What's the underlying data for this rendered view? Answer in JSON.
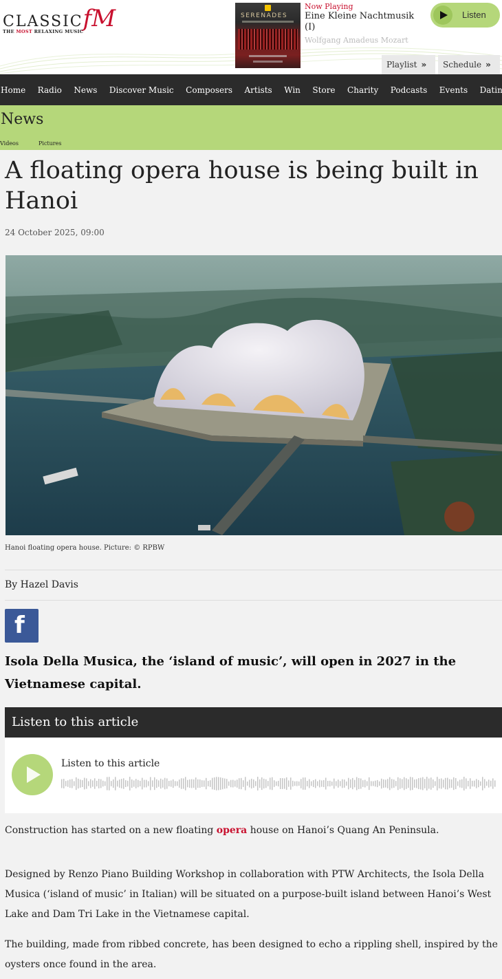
{
  "header": {
    "logo": {
      "main_classic": "CLASSIC",
      "main_fm": "fM",
      "tagline_pre": "THE ",
      "tagline_red": "MOST",
      "tagline_post": " RELAXING MUSIC"
    },
    "album_art": {
      "title": "SERENADES"
    },
    "now_playing": {
      "label": "Now Playing",
      "title": "Eine Kleine Nachtmusik (I)",
      "composer": "Wolfgang Amadeus Mozart"
    },
    "listen_label": "Listen",
    "playlist_label": "Playlist",
    "schedule_label": "Schedule",
    "chevron": "»"
  },
  "nav": {
    "items": [
      "Home",
      "Radio",
      "News",
      "Discover Music",
      "Composers",
      "Artists",
      "Win",
      "Store",
      "Charity",
      "Podcasts",
      "Events",
      "Dating"
    ]
  },
  "section": {
    "title": "News",
    "subnav": [
      "Videos",
      "Pictures"
    ]
  },
  "article": {
    "headline": "A floating opera house is being built in Hanoi",
    "date": "24 October 2025, 09:00",
    "caption": "Hanoi floating opera house. Picture: © RPBW",
    "byline": "By Hazel Davis",
    "facebook_glyph": "f",
    "standfirst": "Isola Della Musica, the ‘island of music’, will open in 2027 in the Vietnamese capital.",
    "audio": {
      "header": "Listen to this article",
      "title": "Listen to this article"
    },
    "paragraphs": {
      "p1_pre": "Construction has started on a new floating ",
      "p1_link": "opera",
      "p1_post": " house on Hanoi’s Quang An Peninsula.",
      "p2": "Designed by Renzo Piano Building Workshop in collaboration with PTW Architects, the Isola Della Musica (‘island of music’ in Italian) will be situated on a purpose-built island between Hanoi’s West Lake and Dam Tri Lake in the Vietnamese capital.",
      "p3": "The building, made from ribbed concrete, has been designed to echo a rippling shell, inspired by the oysters once found in the area."
    }
  },
  "colors": {
    "brand_red": "#c8102e",
    "accent_green": "#b5d77a",
    "nav_dark": "#2b2b2b",
    "facebook_blue": "#3b5998"
  }
}
